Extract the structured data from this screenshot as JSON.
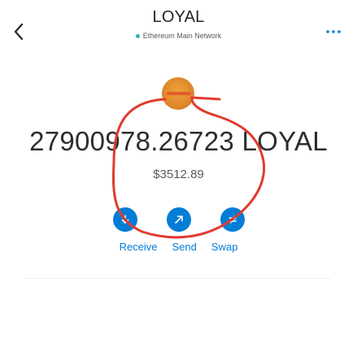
{
  "header": {
    "title": "LOYAL",
    "network": "Ethereum Main Network"
  },
  "icons": {
    "back": "chevron-left-icon",
    "more": "ellipsis-icon",
    "receive": "arrow-down-icon",
    "send": "arrow-up-right-icon",
    "swap": "swap-arrows-icon"
  },
  "asset": {
    "balance": "27900978.26723 LOYAL",
    "fiat_value": "$3512.89"
  },
  "actions": {
    "receive_label": "Receive",
    "send_label": "Send",
    "swap_label": "Swap"
  },
  "colors": {
    "accent": "#037dd6",
    "network_dot": "#29b6af",
    "annotation": "#e03b2f",
    "token_logo": "#e08a2c"
  }
}
